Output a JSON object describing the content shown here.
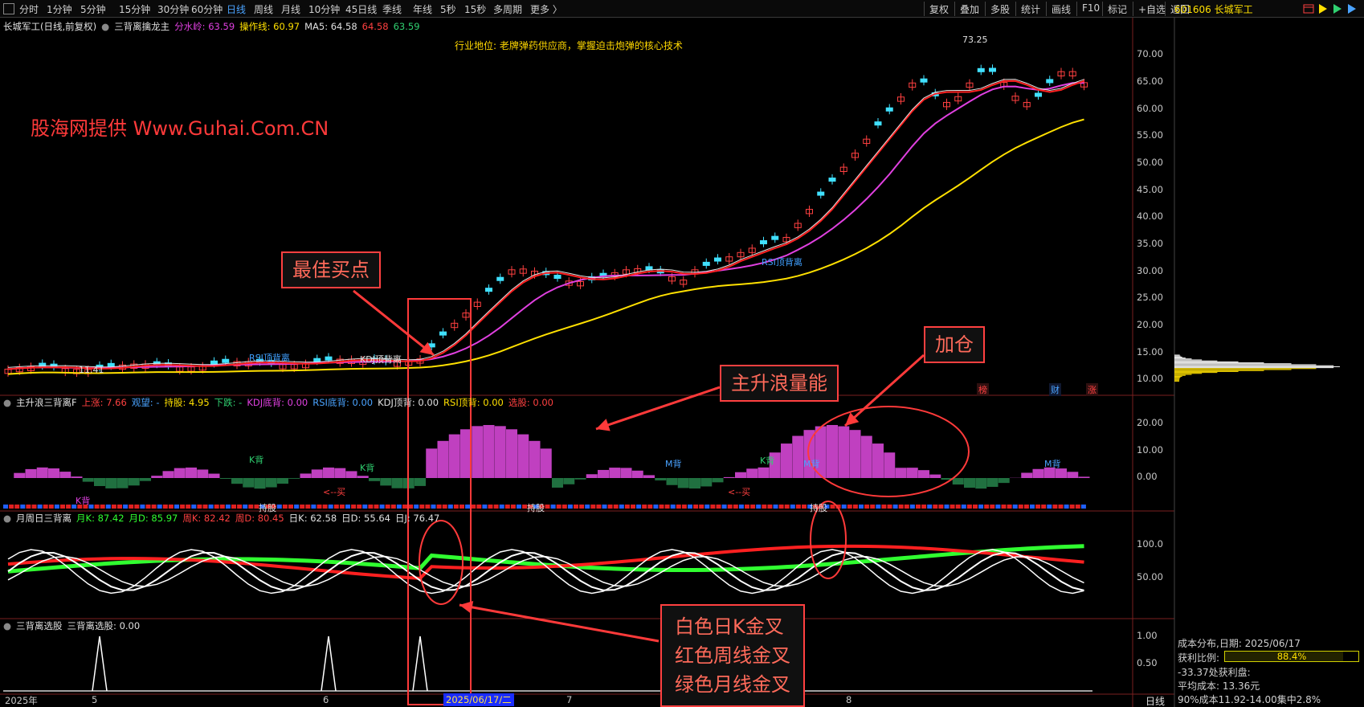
{
  "toolbar": {
    "periods": [
      "分时",
      "1分钟",
      "5分钟",
      "15分钟",
      "30分钟",
      "60分钟",
      "日线",
      "周线",
      "月线",
      "10分钟",
      "45日线",
      "季线",
      "年线",
      "5秒",
      "15秒",
      "多周期",
      "更多 〉"
    ],
    "active_period": "日线",
    "right_buttons": [
      "复权",
      "叠加",
      "多股",
      "统计",
      "画线",
      "F10",
      "标记",
      "+自选",
      "返回"
    ],
    "stock": "601606 长城军工"
  },
  "main_pane": {
    "title": "长城军工(日线,前复权)",
    "indicator": "三背离擒龙主",
    "items": [
      {
        "label": "分水岭: 63.59",
        "color": "#e040e0"
      },
      {
        "label": "操作线: 60.97",
        "color": "#ffe000"
      },
      {
        "label": "MA5: 64.58",
        "color": "#e0e0e0"
      },
      {
        "label": "64.58",
        "color": "#ff4040"
      },
      {
        "label": "63.59",
        "color": "#30d070"
      }
    ],
    "industry_text": "行业地位: 老牌弹药供应商，掌握迫击炮弹的核心技术",
    "watermark": "股海网提供 Www.Guhai.Com.CN",
    "high_label": "73.25",
    "low_label": "11.41",
    "y_labels": [
      "70.00",
      "65.00",
      "60.00",
      "55.00",
      "50.00",
      "45.00",
      "40.00",
      "35.00",
      "30.00",
      "25.00",
      "20.00",
      "15.00",
      "10.00"
    ],
    "annotations": [
      {
        "text": "RSI顶背离",
        "color": "#40a0ff"
      },
      {
        "text": "KDJ顶背离",
        "color": "#e0e0e0"
      },
      {
        "text": "RSI顶背离",
        "color": "#40a0ff"
      }
    ],
    "badges": [
      {
        "text": "榜",
        "color": "#ff4040"
      },
      {
        "text": "财",
        "color": "#4aa3ff"
      },
      {
        "text": "涨",
        "color": "#ff4040"
      }
    ]
  },
  "pane2": {
    "title": "主升浪三背离F",
    "items": [
      {
        "label": "上涨: 7.66",
        "color": "#ff4040"
      },
      {
        "label": "观望: -",
        "color": "#4aa3ff"
      },
      {
        "label": "持股: 4.95",
        "color": "#ffe000"
      },
      {
        "label": "下跌: -",
        "color": "#30d070"
      },
      {
        "label": "KDJ底背: 0.00",
        "color": "#e040e0"
      },
      {
        "label": "RSI底背: 0.00",
        "color": "#4aa3ff"
      },
      {
        "label": "KDJ顶背: 0.00",
        "color": "#e0e0e0"
      },
      {
        "label": "RSI顶背: 0.00",
        "color": "#ffe000"
      },
      {
        "label": "选股: 0.00",
        "color": "#ff4040"
      }
    ],
    "y_labels": [
      "20.00",
      "10.00",
      "0.00"
    ],
    "labels": [
      "K背",
      "K背",
      "K背",
      "M背",
      "K背",
      "M背",
      "M背",
      "持股",
      "持股",
      "持股",
      "<--买",
      "<--买"
    ]
  },
  "pane3": {
    "title": "月周日三背离",
    "items": [
      {
        "label": "月K: 87.42",
        "color": "#30ff30"
      },
      {
        "label": "月D: 85.97",
        "color": "#30ff30"
      },
      {
        "label": "周K: 82.42",
        "color": "#ff4040"
      },
      {
        "label": "周D: 80.45",
        "color": "#ff4040"
      },
      {
        "label": "日K: 62.58",
        "color": "#e0e0e0"
      },
      {
        "label": "日D: 55.64",
        "color": "#e0e0e0"
      },
      {
        "label": "日J: 76.47",
        "color": "#e0e0e0"
      }
    ],
    "y_labels": [
      "100.0",
      "50.00"
    ]
  },
  "pane4": {
    "title": "三背离选股",
    "items": [
      {
        "label": "三背离选股: 0.00",
        "color": "#e0e0e0"
      }
    ],
    "y_labels": [
      "1.00",
      "0.50"
    ]
  },
  "callouts": {
    "best_buy": "最佳买点",
    "add_position": "加仓",
    "main_wave": "主升浪量能",
    "cross_lines": [
      "白色日K金叉",
      "红色周线金叉",
      "绿色月线金叉"
    ]
  },
  "time_axis": {
    "labels": [
      "2025年",
      "5",
      "6",
      "7",
      "8"
    ],
    "cursor_date": "2025/06/17/二",
    "period": "日线"
  },
  "cost_panel": {
    "title": "成本分布,日期: 2025/06/17",
    "ratio_label": "获利比例:",
    "ratio_value": "88.4%",
    "ratio": 0.884,
    "line3": "-33.37处获利盘:",
    "line4": "平均成本: 13.36元",
    "line5": "90%成本11.92-14.00集中2.8%"
  },
  "colors": {
    "up": "#ff4040",
    "down": "#40e0ff",
    "ma_red": "#ff2020",
    "ma_magenta": "#e040e0",
    "operation_yellow": "#ffe000",
    "callout": "#ff4040"
  }
}
